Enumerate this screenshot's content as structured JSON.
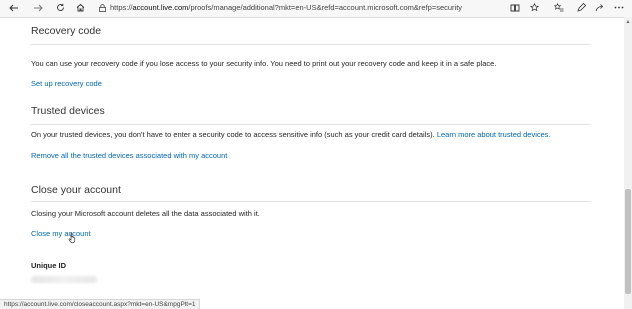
{
  "browser": {
    "url_host": "account.live.com",
    "url_path": "/proofs/manage/additional?mkt=en-US&refd=account.microsoft.com&refp=security"
  },
  "recovery": {
    "title": "Recovery code",
    "description": "You can use your recovery code if you lose access to your security info. You need to print out your recovery code and keep it in a safe place.",
    "link": "Set up recovery code"
  },
  "trusted": {
    "title": "Trusted devices",
    "description": "On your trusted devices, you don't have to enter a security code to access sensitive info (such as your credit card details).",
    "learn_more": "Learn more about trusted devices.",
    "link": "Remove all the trusted devices associated with my account"
  },
  "close": {
    "title": "Close your account",
    "description": "Closing your Microsoft account deletes all the data associated with it.",
    "link": "Close my account"
  },
  "unique_id": {
    "label": "Unique ID"
  },
  "status_bar": {
    "text": "https://account.live.com/closeaccount.aspx?mkt=en-US&mpgPlt=1"
  },
  "colors": {
    "link": "#0067b8",
    "text": "#262626"
  }
}
